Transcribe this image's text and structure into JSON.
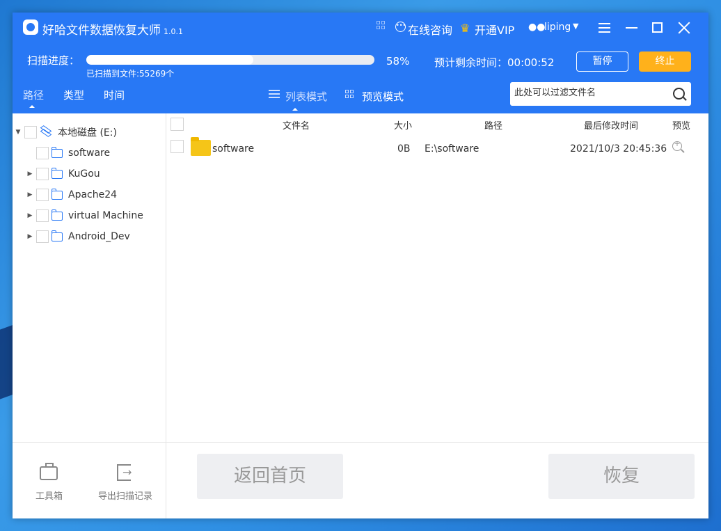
{
  "app": {
    "title": "好哈文件数据恢复大师",
    "version": "1.0.1"
  },
  "titlebar": {
    "consult": "在线咨询",
    "vip": "开通VIP",
    "user": "liping"
  },
  "scan": {
    "label": "扫描进度：",
    "progress_percent": 58,
    "percent_text": "58%",
    "scanned_text": "已扫描到文件:55269个",
    "remaining_text": "预计剩余时间：00:00:52",
    "pause_label": "暂停",
    "stop_label": "终止"
  },
  "tabs": {
    "path": "路径",
    "type": "类型",
    "time": "时间"
  },
  "view_modes": {
    "list": "列表模式",
    "preview": "预览模式"
  },
  "filter": {
    "placeholder": "此处可以过滤文件名"
  },
  "tree": {
    "root": "本地磁盘 (E:)",
    "items": [
      {
        "label": "software",
        "expandable": false
      },
      {
        "label": "KuGou",
        "expandable": true
      },
      {
        "label": "Apache24",
        "expandable": true
      },
      {
        "label": "virtual Machine",
        "expandable": true
      },
      {
        "label": "Android_Dev",
        "expandable": true
      }
    ]
  },
  "table": {
    "columns": {
      "name": "文件名",
      "size": "大小",
      "path": "路径",
      "modified": "最后修改时间",
      "preview": "预览"
    },
    "rows": [
      {
        "name": "software",
        "size": "0B",
        "path": "E:\\software",
        "modified": "2021/10/3 20:45:36"
      }
    ]
  },
  "footer": {
    "toolbox": "工具箱",
    "export": "导出扫描记录",
    "home": "返回首页",
    "recover": "恢复"
  },
  "colors": {
    "brand_blue": "#2878f5",
    "stop_orange": "#ffb11b",
    "folder_yellow": "#f5c518"
  },
  "icons": {
    "logo": "app-logo-icon",
    "grid": "grid-icon",
    "chat": "chat-icon",
    "crown": "crown-icon",
    "wechat": "wechat-icon",
    "menu": "menu-icon",
    "minimize": "minimize-icon",
    "maximize": "maximize-icon",
    "close": "close-icon",
    "search": "search-icon",
    "disk": "disk-icon",
    "folder": "folder-icon",
    "zoom": "zoom-icon",
    "toolbox": "toolbox-icon",
    "export": "export-icon"
  }
}
